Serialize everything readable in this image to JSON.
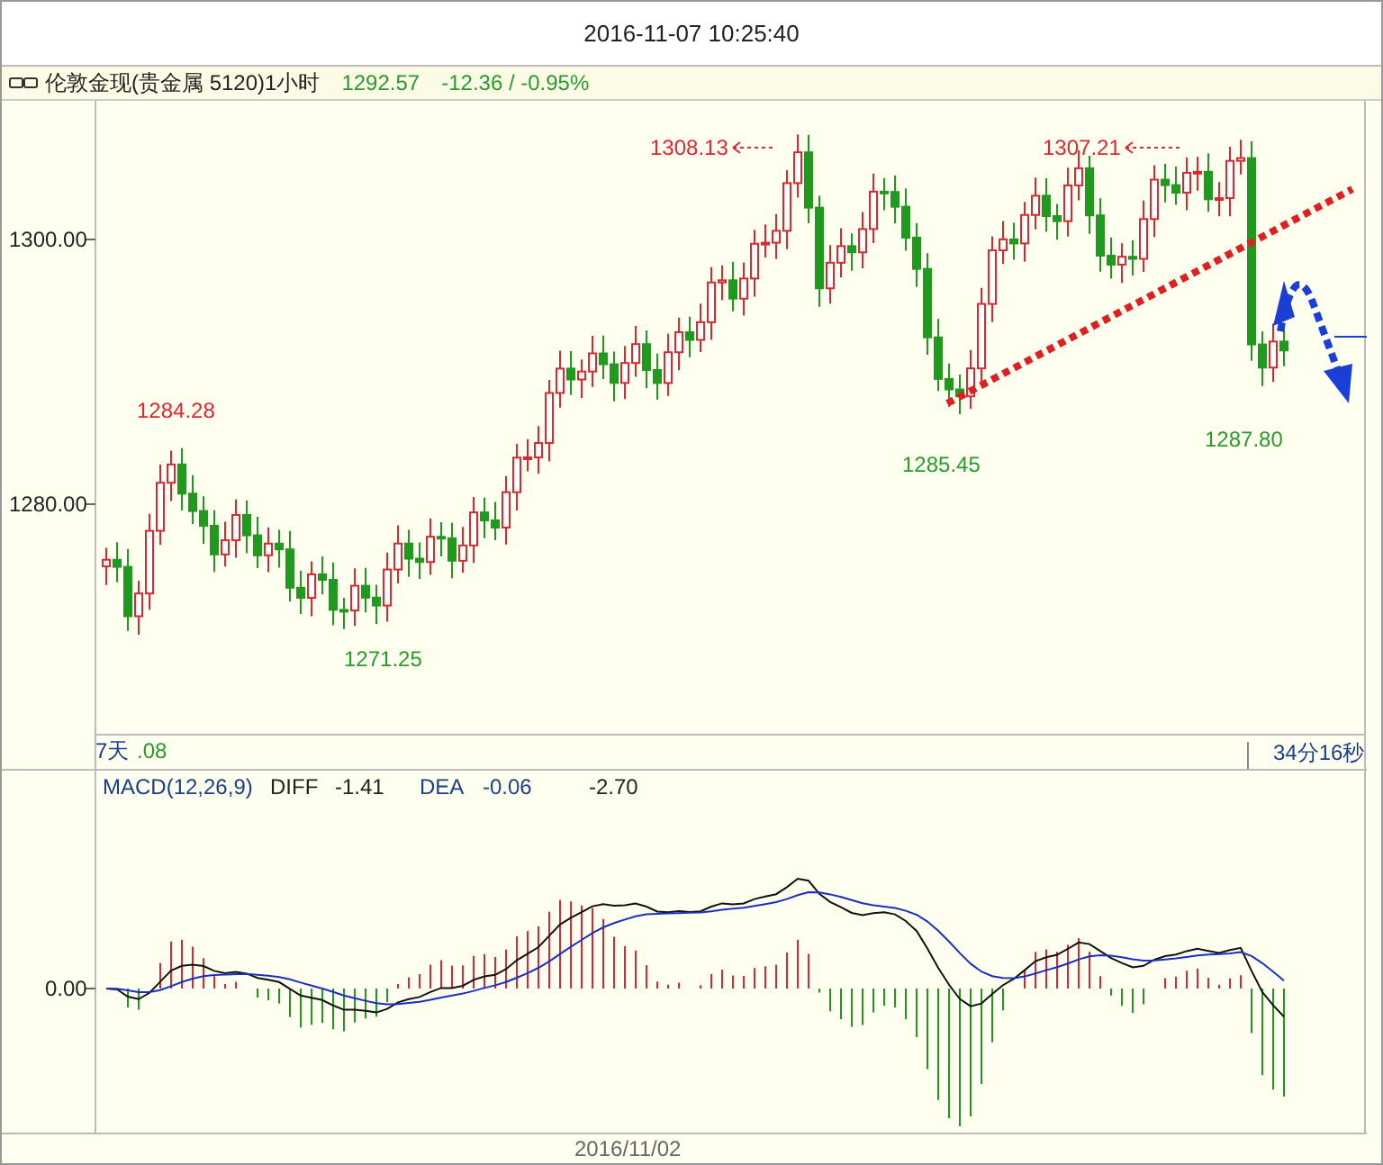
{
  "title": "2016-11-07 10:25:40",
  "info_bar": {
    "symbol": "伦敦金现(贵金属 5120)1小时",
    "price": "1292.57",
    "change": "-12.36 / -0.95%"
  },
  "price_chart": {
    "y_labels": [
      "1300.00",
      "1280.00"
    ],
    "annotations": [
      {
        "text": "1308.13",
        "kind": "high"
      },
      {
        "text": "1307.21",
        "kind": "high"
      },
      {
        "text": "1284.28",
        "kind": "high"
      },
      {
        "text": "1271.25",
        "kind": "low"
      },
      {
        "text": "1285.45",
        "kind": "low"
      },
      {
        "text": "1287.80",
        "kind": "low"
      }
    ],
    "corner_label": "7天",
    "corner_value": ".08",
    "countdown": "34分16秒"
  },
  "macd": {
    "title": "MACD(12,26,9)",
    "diff_label": "DIFF",
    "diff": "-1.41",
    "dea_label": "DEA",
    "dea": "-0.06",
    "value": "-2.70",
    "y_label": "0.00"
  },
  "x_label": "2016/11/02"
}
